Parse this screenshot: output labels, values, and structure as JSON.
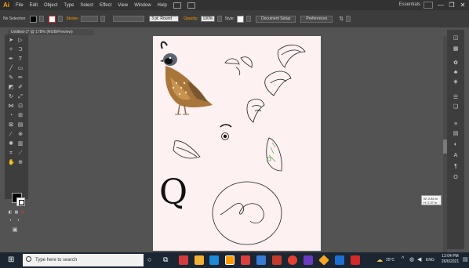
{
  "app": {
    "logo": "Ai",
    "menu": [
      "File",
      "Edit",
      "Object",
      "Type",
      "Select",
      "Effect",
      "View",
      "Window",
      "Help"
    ],
    "workspace": "Essentials",
    "window_controls": [
      "—",
      "❐",
      "✕"
    ]
  },
  "control": {
    "selection_label": "No Selection",
    "stroke_label": "Stroke:",
    "brush_label": "3 pt. Round",
    "opacity_label": "Opacity:",
    "opacity_value": "100%",
    "style_label": "Style:",
    "document_setup": "Document Setup",
    "preferences": "Preferences",
    "colors": {
      "fill": "#000000",
      "stroke": "#d22a2a",
      "opacity_accent": "#ff9a00"
    }
  },
  "document": {
    "tab_title": "Untitled-1* @ 178% (RGB/Preview)"
  },
  "canvas": {
    "letter": "Q",
    "tooltip_line1": "W: 2.84 in",
    "tooltip_line2": "H: 2.37 in"
  },
  "taskbar": {
    "search_placeholder": "Type here to search",
    "weather": "25°C",
    "language": "ENG",
    "time": "12:04 PM",
    "date": "26/6/2021"
  }
}
